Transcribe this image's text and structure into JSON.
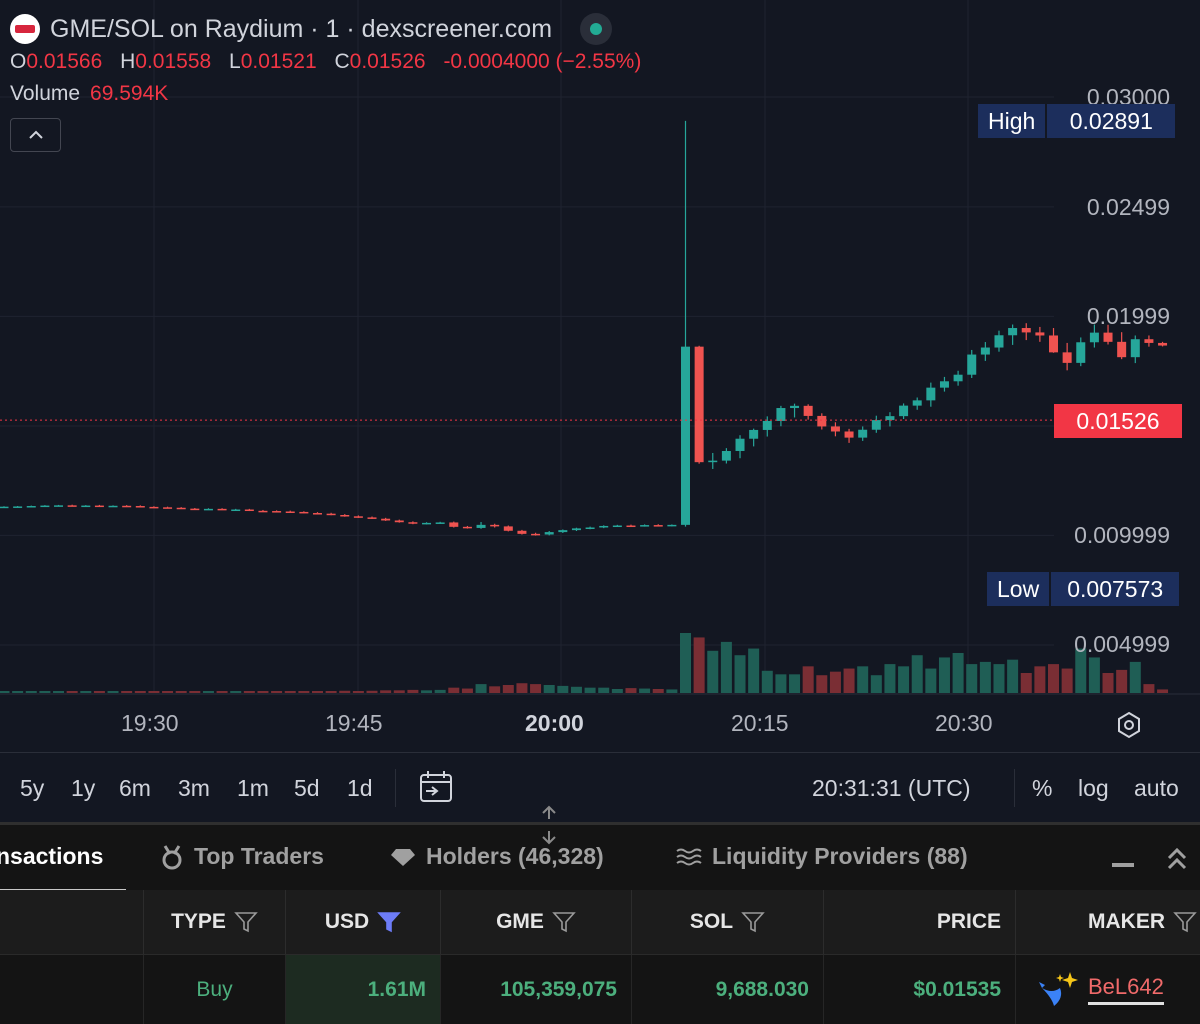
{
  "chart": {
    "title": "GME/SOL on Raydium · 1 · dexscreener.com",
    "ohlc": {
      "o_key": "O",
      "o": "0.01566",
      "h_key": "H",
      "h": "0.01558",
      "l_key": "L",
      "l": "0.01521",
      "c_key": "C",
      "c": "0.01526",
      "change": "-0.0004000 (−2.55%)"
    },
    "volume_label": "Volume",
    "volume_value": "69.594K",
    "price_axis": [
      "0.03000",
      "0.02499",
      "0.01999",
      "0.009999",
      "0.004999"
    ],
    "high_label": "High",
    "high_value": "0.02891",
    "low_label": "Low",
    "low_value": "0.007573",
    "last_price": "0.01526",
    "time_axis": [
      "19:30",
      "19:45",
      "20:00",
      "20:15",
      "20:30"
    ],
    "colors": {
      "up": "#26a69a",
      "down": "#ef5350",
      "bg": "#131722"
    }
  },
  "chart_data": {
    "type": "candlestick",
    "x_unit": "time (UTC), 1-minute candles starting 19:21",
    "y_range": [
      0.0025,
      0.031
    ],
    "volume_range": [
      0,
      1
    ],
    "candles": [
      [
        0.01129,
        0.01133,
        0.01127,
        0.01131,
        0.02
      ],
      [
        0.01131,
        0.01134,
        0.01128,
        0.01132,
        0.02
      ],
      [
        0.01132,
        0.01136,
        0.01129,
        0.01134,
        0.02
      ],
      [
        0.01134,
        0.01138,
        0.01131,
        0.01136,
        0.02
      ],
      [
        0.01136,
        0.01139,
        0.01133,
        0.01137,
        0.02
      ],
      [
        0.01137,
        0.0114,
        0.01134,
        0.01135,
        0.02
      ],
      [
        0.01135,
        0.01138,
        0.01132,
        0.01136,
        0.02
      ],
      [
        0.01136,
        0.01139,
        0.01133,
        0.01134,
        0.02
      ],
      [
        0.01134,
        0.01137,
        0.01131,
        0.01135,
        0.02
      ],
      [
        0.01135,
        0.01138,
        0.01132,
        0.01134,
        0.02
      ],
      [
        0.01134,
        0.01137,
        0.01129,
        0.0113,
        0.03
      ],
      [
        0.0113,
        0.01133,
        0.01126,
        0.01128,
        0.02
      ],
      [
        0.01128,
        0.01131,
        0.01124,
        0.01126,
        0.03
      ],
      [
        0.01126,
        0.01129,
        0.01121,
        0.01122,
        0.03
      ],
      [
        0.01122,
        0.01125,
        0.01118,
        0.01119,
        0.03
      ],
      [
        0.01119,
        0.01124,
        0.01117,
        0.01121,
        0.02
      ],
      [
        0.01121,
        0.01124,
        0.01116,
        0.01117,
        0.03
      ],
      [
        0.01117,
        0.01121,
        0.01114,
        0.01118,
        0.02
      ],
      [
        0.01118,
        0.01121,
        0.01111,
        0.01112,
        0.03
      ],
      [
        0.01112,
        0.01116,
        0.01109,
        0.01111,
        0.03
      ],
      [
        0.01111,
        0.01114,
        0.01107,
        0.01109,
        0.03
      ],
      [
        0.01109,
        0.01113,
        0.01105,
        0.01107,
        0.03
      ],
      [
        0.01107,
        0.0111,
        0.01101,
        0.01102,
        0.04
      ],
      [
        0.01102,
        0.01106,
        0.01097,
        0.01099,
        0.04
      ],
      [
        0.01099,
        0.01103,
        0.01092,
        0.01093,
        0.04
      ],
      [
        0.01093,
        0.01097,
        0.01085,
        0.01087,
        0.05
      ],
      [
        0.01087,
        0.01091,
        0.0108,
        0.01082,
        0.04
      ],
      [
        0.01082,
        0.01086,
        0.01075,
        0.01076,
        0.05
      ],
      [
        0.01076,
        0.0108,
        0.01066,
        0.01068,
        0.06
      ],
      [
        0.01068,
        0.01072,
        0.01058,
        0.0106,
        0.06
      ],
      [
        0.0106,
        0.01064,
        0.01051,
        0.01054,
        0.07
      ],
      [
        0.01054,
        0.0106,
        0.0105,
        0.01057,
        0.06
      ],
      [
        0.01057,
        0.01062,
        0.01053,
        0.01059,
        0.07
      ],
      [
        0.01059,
        0.01063,
        0.01036,
        0.01039,
        0.12
      ],
      [
        0.01039,
        0.01043,
        0.01031,
        0.01034,
        0.1
      ],
      [
        0.01034,
        0.01061,
        0.0103,
        0.01048,
        0.2
      ],
      [
        0.01048,
        0.01053,
        0.01036,
        0.01041,
        0.15
      ],
      [
        0.01041,
        0.01045,
        0.01018,
        0.01021,
        0.18
      ],
      [
        0.01021,
        0.01025,
        0.01004,
        0.01007,
        0.22
      ],
      [
        0.01007,
        0.01012,
        0.00999,
        0.01004,
        0.2
      ],
      [
        0.01004,
        0.0102,
        0.01,
        0.01015,
        0.18
      ],
      [
        0.01015,
        0.01027,
        0.01011,
        0.01024,
        0.16
      ],
      [
        0.01024,
        0.01035,
        0.0102,
        0.01032,
        0.14
      ],
      [
        0.01032,
        0.0104,
        0.01028,
        0.01036,
        0.12
      ],
      [
        0.01036,
        0.01046,
        0.01033,
        0.01043,
        0.12
      ],
      [
        0.01043,
        0.01048,
        0.01039,
        0.01045,
        0.09
      ],
      [
        0.01045,
        0.01049,
        0.0104,
        0.01043,
        0.11
      ],
      [
        0.01043,
        0.0105,
        0.0104,
        0.01047,
        0.1
      ],
      [
        0.01047,
        0.01051,
        0.01041,
        0.01044,
        0.09
      ],
      [
        0.01044,
        0.0105,
        0.01041,
        0.01048,
        0.08
      ],
      [
        0.01048,
        0.02891,
        0.0104,
        0.01861,
        1.35
      ],
      [
        0.01861,
        0.01865,
        0.01327,
        0.01334,
        1.25
      ],
      [
        0.01334,
        0.01376,
        0.01303,
        0.01341,
        0.95
      ],
      [
        0.01341,
        0.01398,
        0.01328,
        0.01385,
        1.15
      ],
      [
        0.01385,
        0.01457,
        0.01352,
        0.01441,
        0.85
      ],
      [
        0.01441,
        0.01487,
        0.01406,
        0.01481,
        1.0
      ],
      [
        0.01481,
        0.01543,
        0.01451,
        0.01522,
        0.5
      ],
      [
        0.01522,
        0.01591,
        0.01498,
        0.01581,
        0.42
      ],
      [
        0.01581,
        0.01601,
        0.01538,
        0.01591,
        0.42
      ],
      [
        0.01591,
        0.01598,
        0.01528,
        0.01545,
        0.6
      ],
      [
        0.01545,
        0.01557,
        0.01483,
        0.01497,
        0.4
      ],
      [
        0.01497,
        0.01516,
        0.01452,
        0.01474,
        0.48
      ],
      [
        0.01474,
        0.01486,
        0.01422,
        0.01446,
        0.55
      ],
      [
        0.01446,
        0.01497,
        0.01431,
        0.01482,
        0.6
      ],
      [
        0.01482,
        0.01546,
        0.01468,
        0.01526,
        0.4
      ],
      [
        0.01526,
        0.01562,
        0.01497,
        0.01544,
        0.65
      ],
      [
        0.01544,
        0.01602,
        0.01531,
        0.01592,
        0.6
      ],
      [
        0.01592,
        0.01629,
        0.01573,
        0.01616,
        0.85
      ],
      [
        0.01616,
        0.01697,
        0.01587,
        0.01674,
        0.55
      ],
      [
        0.01674,
        0.01723,
        0.01656,
        0.01703,
        0.8
      ],
      [
        0.01703,
        0.01751,
        0.01683,
        0.01733,
        0.9
      ],
      [
        0.01733,
        0.01846,
        0.01718,
        0.01825,
        0.65
      ],
      [
        0.01825,
        0.01882,
        0.01796,
        0.01857,
        0.7
      ],
      [
        0.01857,
        0.01934,
        0.01838,
        0.01913,
        0.65
      ],
      [
        0.01913,
        0.01962,
        0.01869,
        0.01946,
        0.75
      ],
      [
        0.01946,
        0.01968,
        0.01891,
        0.01926,
        0.45
      ],
      [
        0.01926,
        0.01951,
        0.01883,
        0.01912,
        0.6
      ],
      [
        0.01912,
        0.01946,
        0.01833,
        0.01835,
        0.65
      ],
      [
        0.01835,
        0.01878,
        0.01753,
        0.01787,
        0.55
      ],
      [
        0.01787,
        0.01903,
        0.01772,
        0.01881,
        1.0
      ],
      [
        0.01881,
        0.01962,
        0.01857,
        0.01925,
        0.8
      ],
      [
        0.01925,
        0.01961,
        0.01871,
        0.01883,
        0.45
      ],
      [
        0.01883,
        0.01927,
        0.01804,
        0.01813,
        0.52
      ],
      [
        0.01813,
        0.01912,
        0.01786,
        0.01895,
        0.7
      ],
      [
        0.01895,
        0.01912,
        0.01861,
        0.01878,
        0.2
      ],
      [
        0.01878,
        0.01883,
        0.01862,
        0.01866,
        0.08
      ]
    ],
    "candle_fields": [
      "open",
      "high",
      "low",
      "close",
      "volume_relative"
    ],
    "high": 0.02891,
    "low": 0.007573,
    "last": 0.01526
  },
  "toolbar": {
    "ranges": [
      "5y",
      "1y",
      "6m",
      "3m",
      "1m",
      "5d",
      "1d"
    ],
    "clock": "20:31:31 (UTC)",
    "percent": "%",
    "log": "log",
    "auto": "auto"
  },
  "panel": {
    "tabs": [
      "nsactions",
      "Top Traders",
      "Holders (46,328)",
      "Liquidity Providers (88)"
    ]
  },
  "table": {
    "headers": {
      "type": "TYPE",
      "usd": "USD",
      "gme": "GME",
      "sol": "SOL",
      "price": "PRICE",
      "maker": "MAKER"
    },
    "row": {
      "type": "Buy",
      "usd": "1.61M",
      "gme": "105,359,075",
      "sol": "9,688.030",
      "price": "$0.01535",
      "maker": "BeL642"
    }
  }
}
